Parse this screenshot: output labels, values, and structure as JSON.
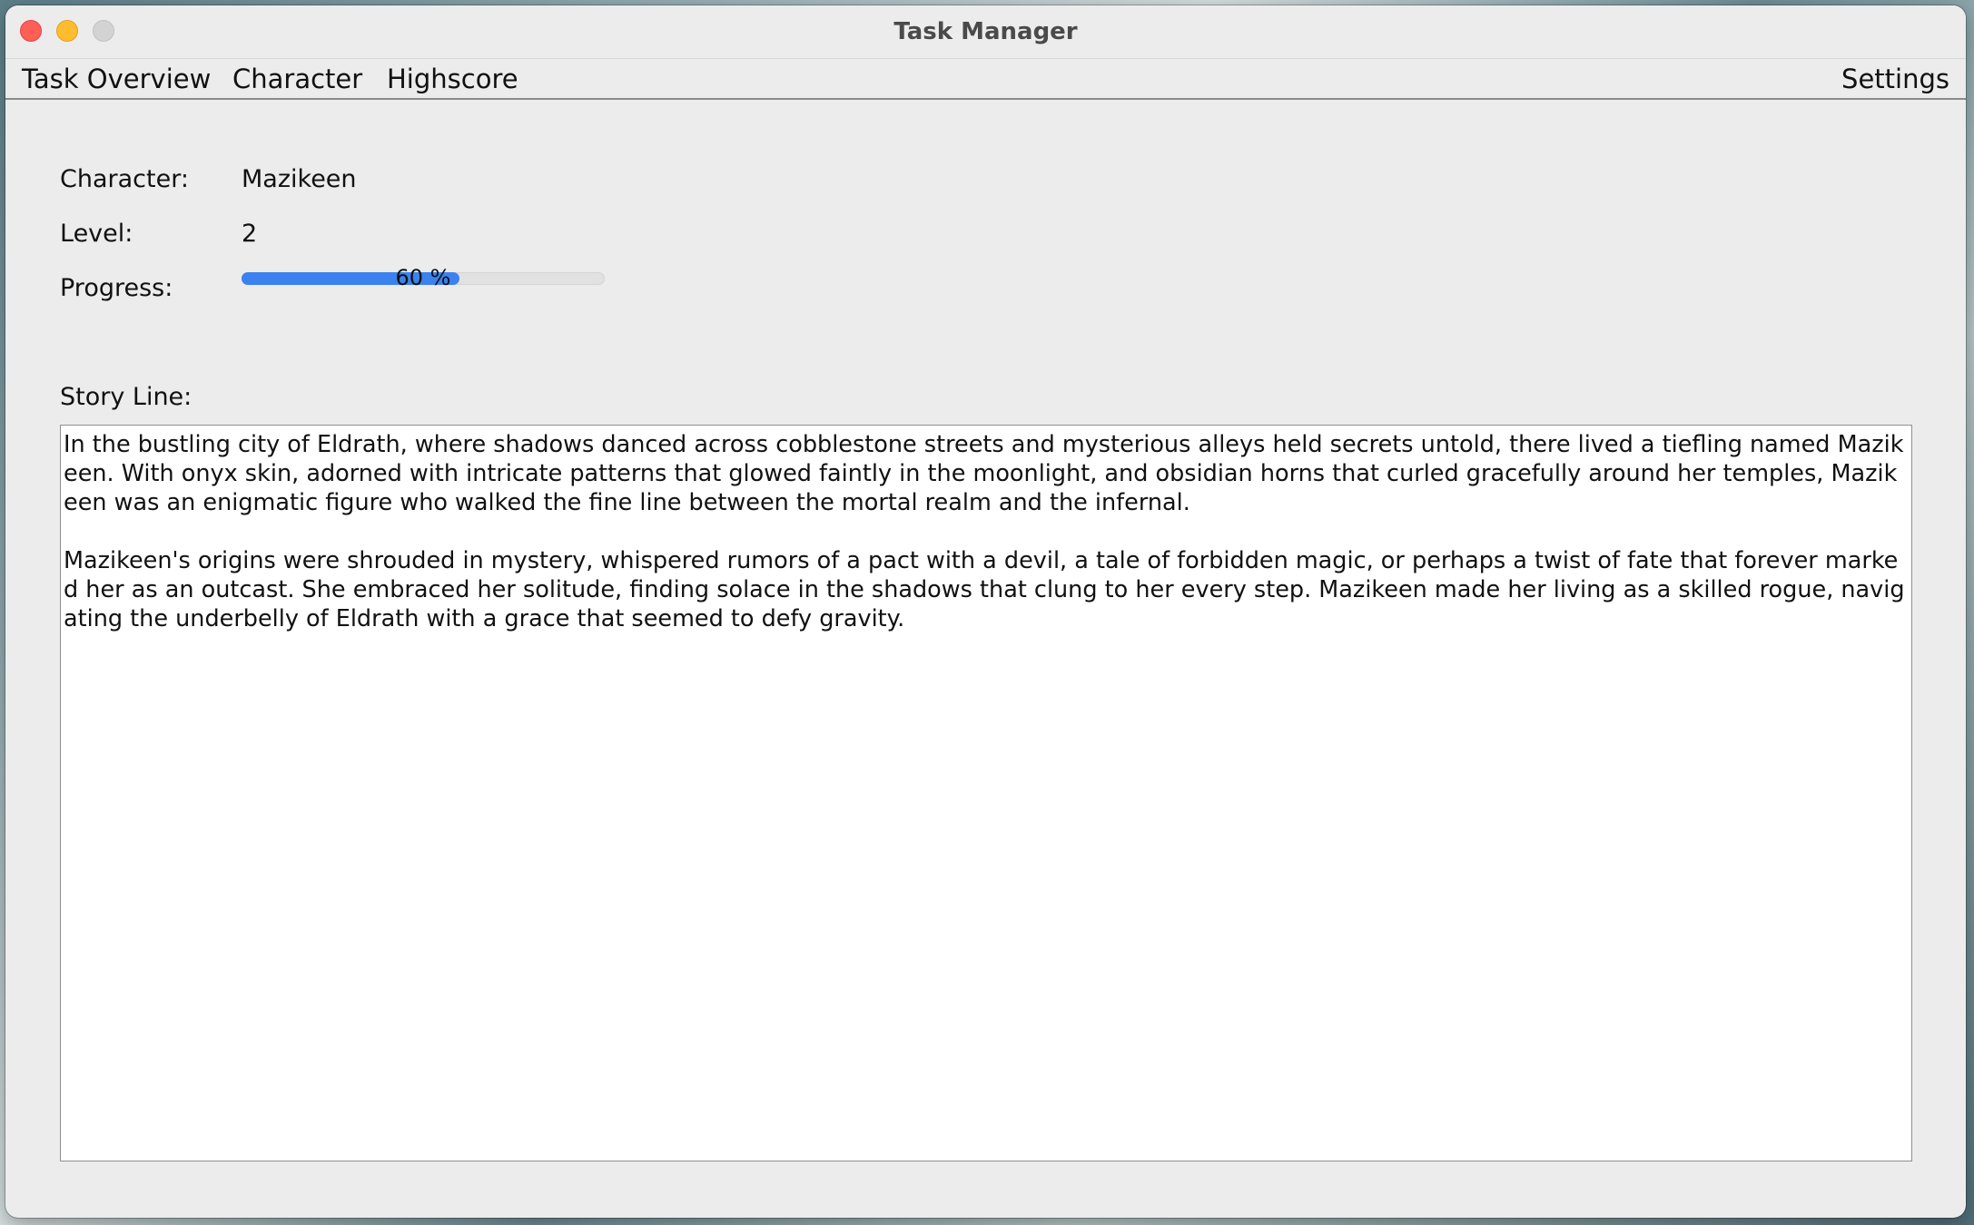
{
  "window": {
    "title": "Task Manager"
  },
  "menu": {
    "items": [
      {
        "label": "Task Overview"
      },
      {
        "label": "Character"
      },
      {
        "label": "Highscore"
      }
    ],
    "settings_label": "Settings"
  },
  "character": {
    "character_label": "Character:",
    "character_name": "Mazikeen",
    "level_label": "Level:",
    "level_value": "2",
    "progress_label": "Progress:",
    "progress_percent": 60,
    "progress_text": "60 %"
  },
  "story": {
    "label": "Story Line:",
    "text": "In the bustling city of Eldrath, where shadows danced across cobblestone streets and mysterious alleys held secrets untold, there lived a tiefling named Mazikeen. With onyx skin, adorned with intricate patterns that glowed faintly in the moonlight, and obsidian horns that curled gracefully around her temples, Mazikeen was an enigmatic figure who walked the fine line between the mortal realm and the infernal.\n\nMazikeen's origins were shrouded in mystery, whispered rumors of a pact with a devil, a tale of forbidden magic, or perhaps a twist of fate that forever marked her as an outcast. She embraced her solitude, finding solace in the shadows that clung to her every step. Mazikeen made her living as a skilled rogue, navigating the underbelly of Eldrath with a grace that seemed to defy gravity."
  },
  "colors": {
    "progress_fill": "#3b82f0",
    "close": "#ff5f57",
    "minimize": "#febc2e",
    "maximize_disabled": "#d3d3d3"
  }
}
